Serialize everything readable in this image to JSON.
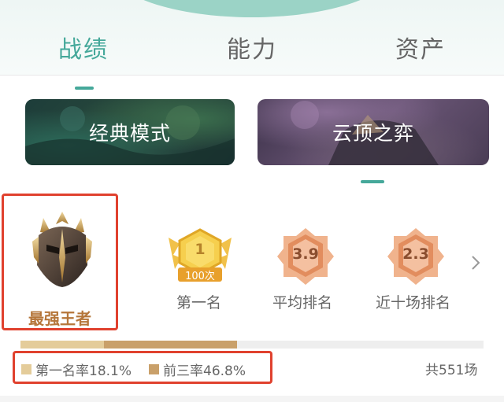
{
  "tabs": [
    {
      "label": "战绩",
      "active": true
    },
    {
      "label": "能力",
      "active": false
    },
    {
      "label": "资产",
      "active": false
    }
  ],
  "modes": {
    "classic_label": "经典模式",
    "tft_label": "云顶之弈",
    "selected": "云顶之弈"
  },
  "rank": {
    "name": "最强王者",
    "icon": "challenger-helmet-icon"
  },
  "stats": [
    {
      "badge_text": "1",
      "sub_text": "100次",
      "label": "第一名",
      "icon": "gold-first-place-badge-icon"
    },
    {
      "badge_text": "3.9",
      "label": "平均排名",
      "icon": "bronze-hexagon-badge-icon"
    },
    {
      "badge_text": "2.3",
      "label": "近十场排名",
      "icon": "bronze-hexagon-badge-icon"
    }
  ],
  "rates": {
    "first_label": "第一名率18.1%",
    "top3_label": "前三率46.8%",
    "first_rate": 0.181,
    "top3_rate": 0.468,
    "total_label": "共551场"
  },
  "colors": {
    "accent": "#45a89a",
    "highlight_border": "#e0412e",
    "first_rate": "#e4cc9a",
    "top3_rate": "#c9a06a",
    "rank_text": "#b5763a"
  }
}
